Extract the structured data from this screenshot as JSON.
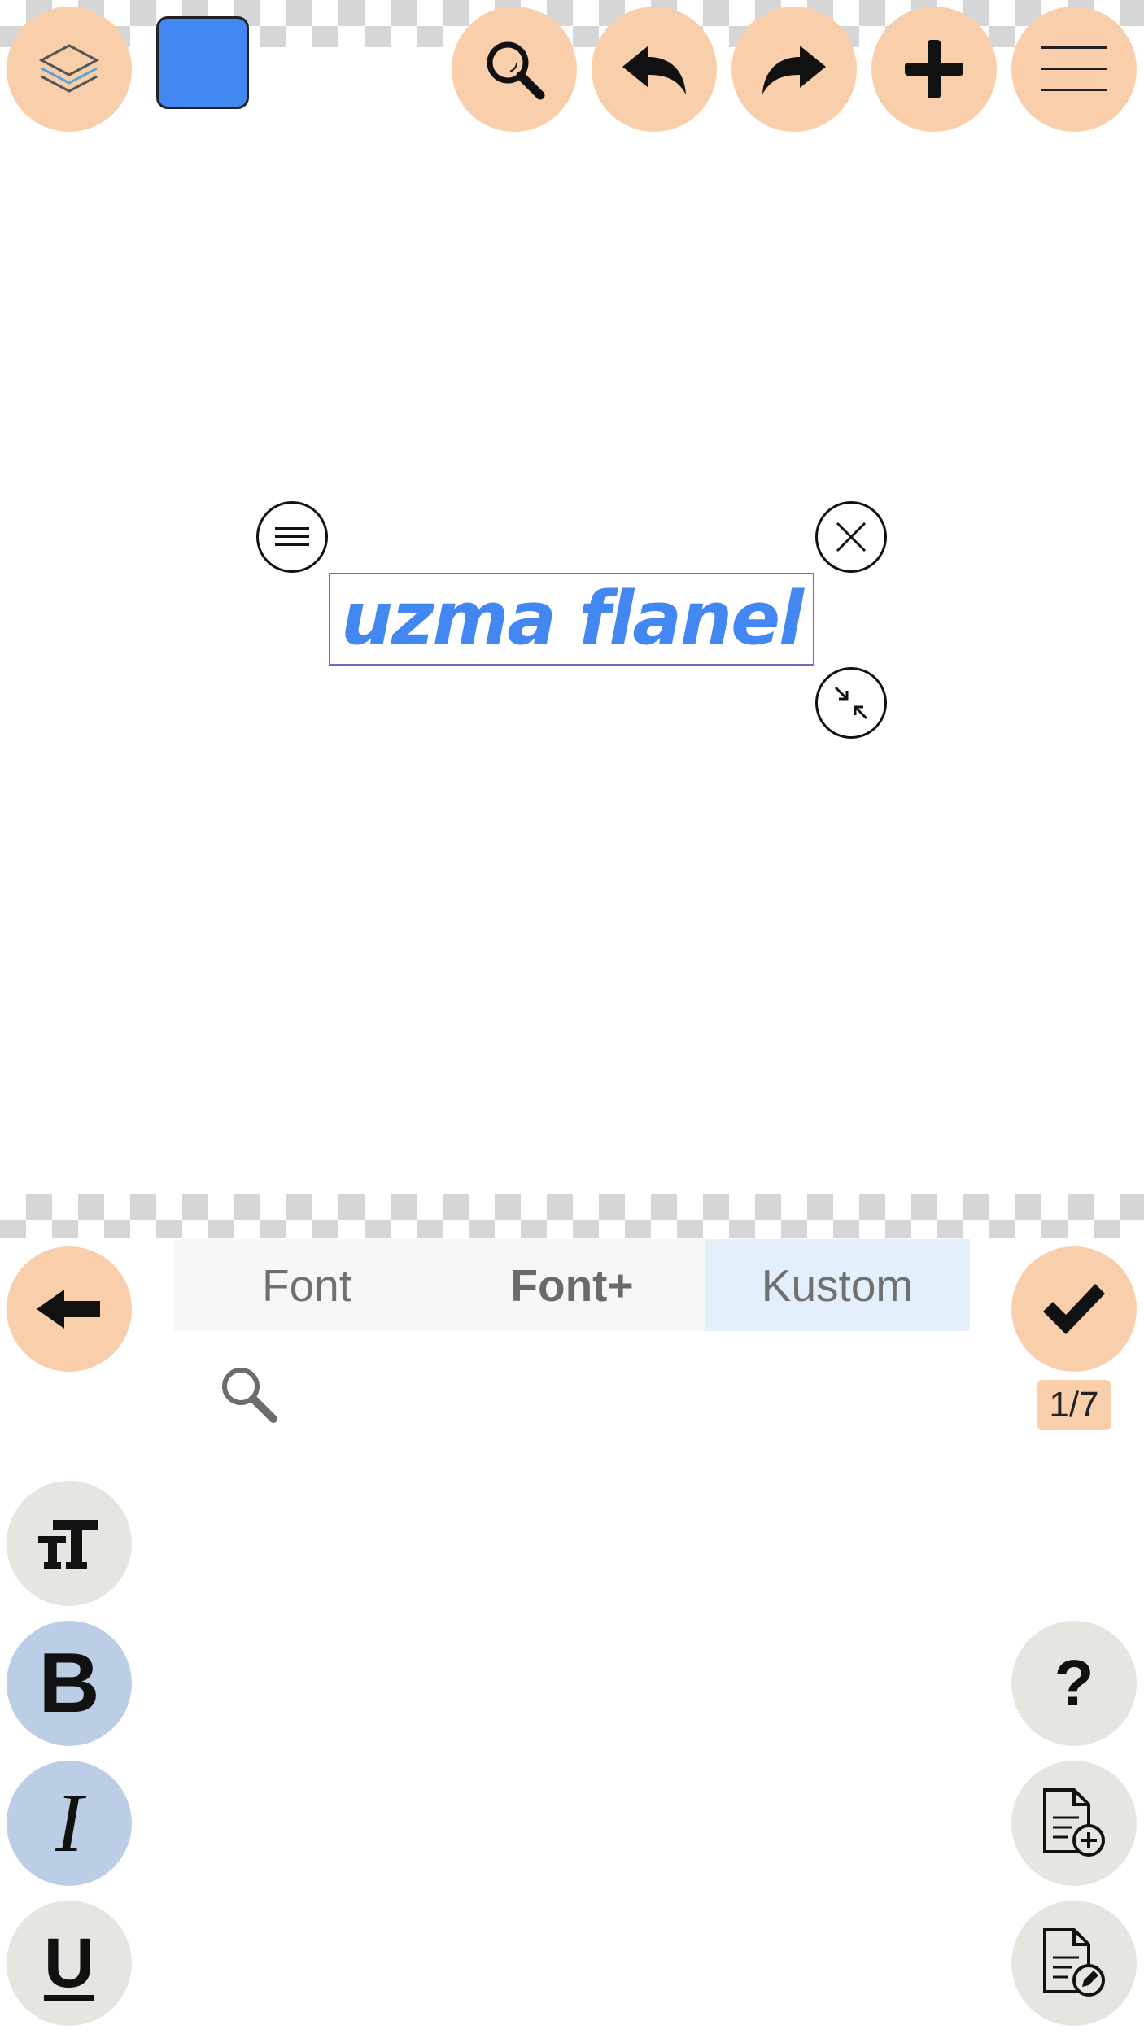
{
  "colors": {
    "accent_peach": "#f9ceaa",
    "selected_color": "#4387f2",
    "text_color": "#4387f2",
    "tab_active_bg": "#e3f0fb"
  },
  "top_toolbar": {
    "icons": [
      "layers-icon",
      "color-swatch",
      "zoom-icon",
      "undo-icon",
      "redo-icon",
      "add-icon",
      "menu-icon"
    ]
  },
  "canvas": {
    "text": "uzma flanel",
    "handles": [
      "menu-handle-icon",
      "close-handle-icon",
      "resize-handle-icon"
    ]
  },
  "font_panel": {
    "tabs": [
      {
        "label": "Font",
        "active": false
      },
      {
        "label": "Font+",
        "active": false,
        "bold": true
      },
      {
        "label": "Kustom",
        "active": true
      }
    ],
    "search_icon": "search-icon",
    "page_indicator": "1/7",
    "style_buttons": {
      "size": "tT",
      "bold": "B",
      "italic": "I",
      "underline": "U",
      "help": "?"
    }
  }
}
